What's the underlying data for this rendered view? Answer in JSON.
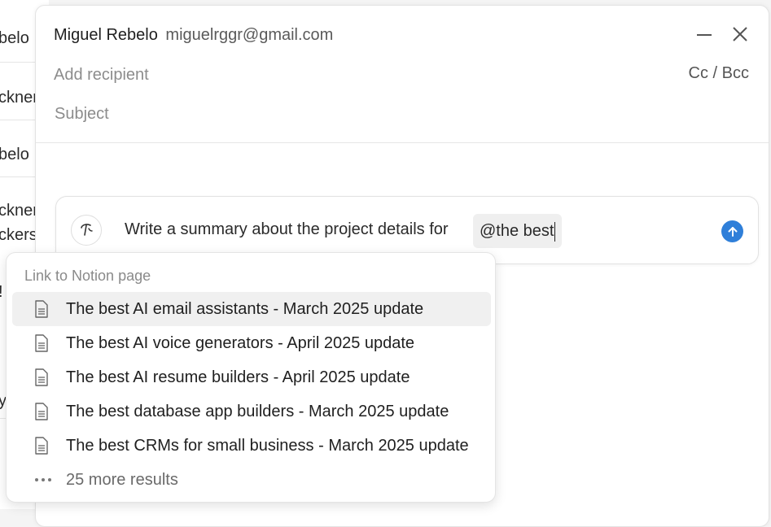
{
  "background_list": {
    "rows": [
      {
        "text": "belo"
      },
      {
        "text": "ckner"
      },
      {
        "text": "belo"
      },
      {
        "text": "ckner"
      },
      {
        "text": "ckersu"
      },
      {
        "text": "!"
      },
      {
        "text": "y"
      }
    ]
  },
  "compose": {
    "from_name": "Miguel Rebelo",
    "from_email": "miguelrggr@gmail.com",
    "recipient_placeholder": "Add recipient",
    "cc_bcc": "Cc / Bcc",
    "subject_placeholder": "Subject"
  },
  "ai_prompt": {
    "text": "Write a summary about the project details for",
    "mention": "@the best"
  },
  "dropdown": {
    "header": "Link to Notion page",
    "items": [
      {
        "label": "The best AI email assistants - March 2025 update",
        "active": true
      },
      {
        "label": "The best AI voice generators - April 2025 update",
        "active": false
      },
      {
        "label": "The best AI resume builders - April 2025 update",
        "active": false
      },
      {
        "label": "The best database app builders - March 2025 update",
        "active": false
      },
      {
        "label": "The best CRMs for small business - March 2025 update",
        "active": false
      }
    ],
    "more": "25 more results"
  },
  "colors": {
    "accent": "#2f7fd9",
    "highlight": "#f0f0f0"
  }
}
